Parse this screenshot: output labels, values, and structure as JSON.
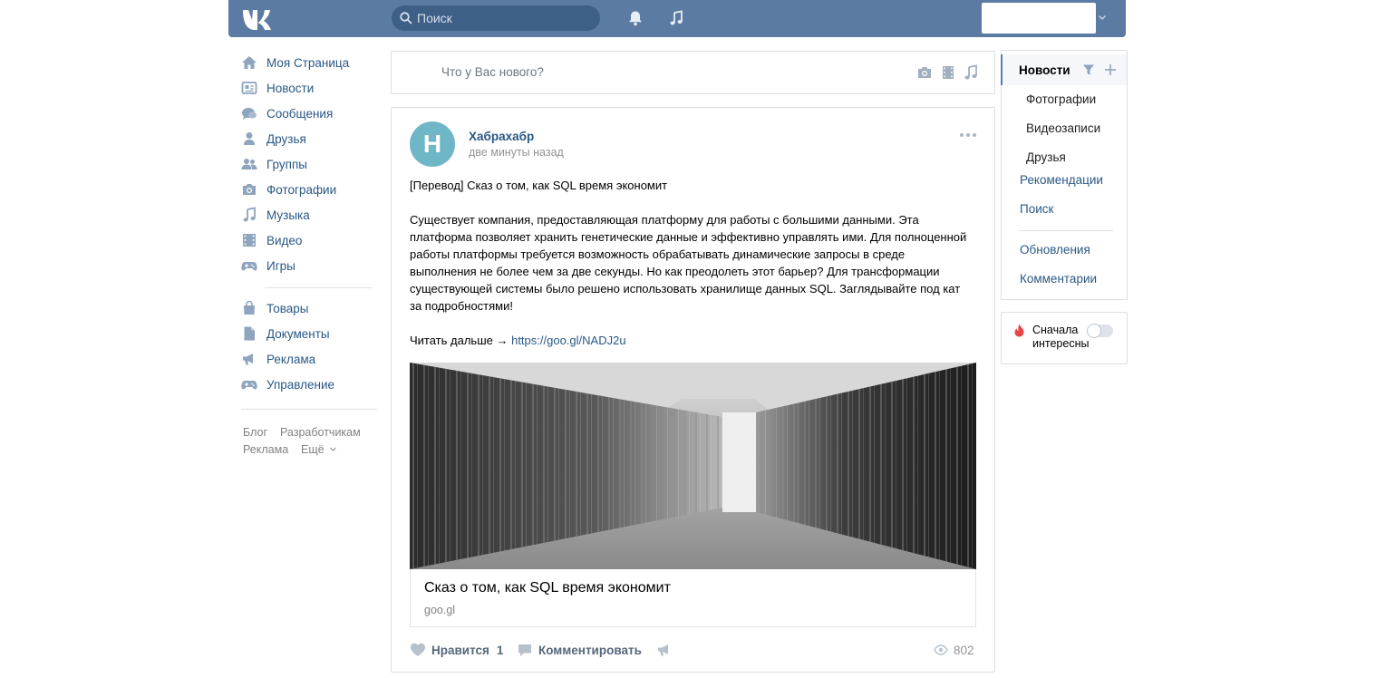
{
  "header": {
    "search_placeholder": "Поиск",
    "brand_color": "#5b7ba3"
  },
  "sidebar": {
    "items": [
      {
        "label": "Моя Страница",
        "icon": "home-icon"
      },
      {
        "label": "Новости",
        "icon": "news-icon"
      },
      {
        "label": "Сообщения",
        "icon": "messages-icon"
      },
      {
        "label": "Друзья",
        "icon": "friends-icon"
      },
      {
        "label": "Группы",
        "icon": "groups-icon"
      },
      {
        "label": "Фотографии",
        "icon": "camera-icon"
      },
      {
        "label": "Музыка",
        "icon": "music-icon"
      },
      {
        "label": "Видео",
        "icon": "video-icon"
      },
      {
        "label": "Игры",
        "icon": "gamepad-icon"
      }
    ],
    "items2": [
      {
        "label": "Товары",
        "icon": "bag-icon"
      },
      {
        "label": "Документы",
        "icon": "document-icon"
      },
      {
        "label": "Реклама",
        "icon": "megaphone-icon"
      },
      {
        "label": "Управление",
        "icon": "gamepad-icon"
      }
    ],
    "footer": {
      "blog": "Блог",
      "developers": "Разработчикам",
      "ads": "Реклама",
      "more": "Ещё"
    }
  },
  "composer": {
    "placeholder": "Что у Вас нового?"
  },
  "post": {
    "avatar_letter": "H",
    "author": "Хабрахабр",
    "time": "две минуты назад",
    "title_line": "[Перевод] Сказ о том, как SQL время экономит",
    "body": "Существует компания, предоставляющая платформу для работы с большими данными. Эта платформа позволяет хранить генетические данные и эффективно управлять ими. Для полноценной работы платформы требуется возможность обрабатывать динамические запросы в среде выполнения не более чем за две секунды. Но как преодолеть этот барьер? Для трансформации существующей системы было решено использовать хранилище данных SQL. Заглядывайте под кат за подробностями!",
    "read_more": "Читать дальше →",
    "link": "https://goo.gl/NADJ2u",
    "card_title": "Сказ о том, как SQL время экономит",
    "card_domain": "goo.gl",
    "like_label": "Нравится",
    "like_count": "1",
    "comment_label": "Комментировать",
    "views": "802"
  },
  "right_menu": {
    "active": "Новости",
    "subitems": [
      "Фотографии",
      "Видеозаписи",
      "Друзья"
    ],
    "links": [
      "Рекомендации",
      "Поиск"
    ],
    "links2": [
      "Обновления",
      "Комментарии"
    ],
    "interest_label": "Сначала интересные"
  }
}
